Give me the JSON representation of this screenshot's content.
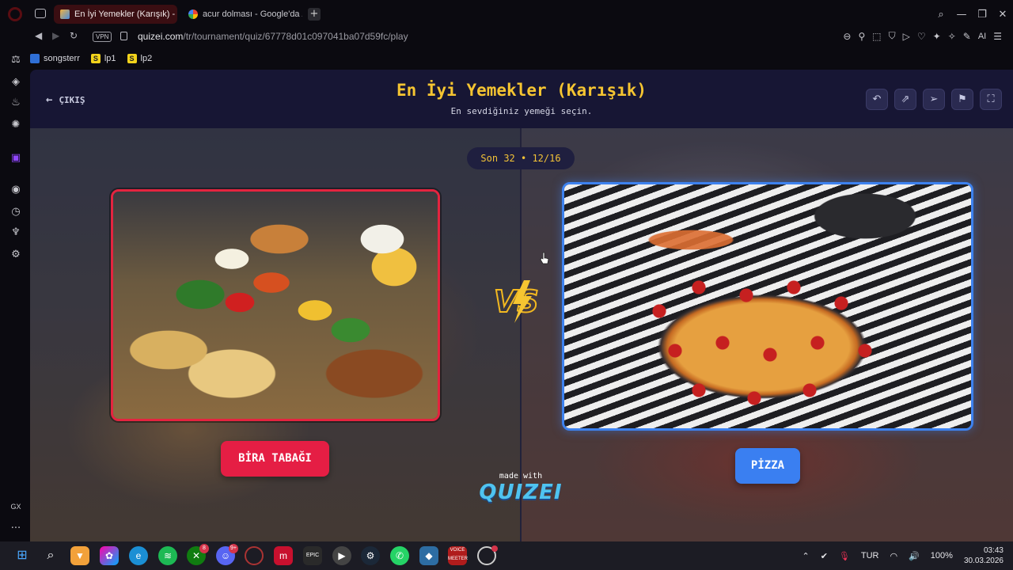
{
  "browser": {
    "tabs": [
      {
        "title": "En İyi Yemekler (Karışık) -",
        "active": true
      },
      {
        "title": "acur dolması - Google'da /",
        "active": false
      }
    ],
    "new_tab_label": "+",
    "vpn_label": "VPN",
    "url_host": "quizei.com",
    "url_path": "/tr/tournament/quiz/67778d01c097041ba07d59fc/play",
    "ai_label": "AI",
    "bookmarks": [
      {
        "label": "songsterr",
        "icon_char": "",
        "icon": "songsterr-icon"
      },
      {
        "label": "lp1",
        "icon_char": "S",
        "icon": "s-icon"
      },
      {
        "label": "lp2",
        "icon_char": "S",
        "icon": "s-icon"
      }
    ],
    "sidebar_gx_label": "GX",
    "sidebar_more_label": "···"
  },
  "page": {
    "back_label": "ÇIKIŞ",
    "title": "En İyi Yemekler (Karışık)",
    "subtitle": "En sevdiğiniz yemeği seçin.",
    "round": "Son 32 • 12/16",
    "left_choice": {
      "label": "BİRA TABAĞI",
      "image": "bira-tabagi-platter"
    },
    "right_choice": {
      "label": "PİZZA",
      "image": "pepperoni-pizza"
    },
    "vs_label": "VS",
    "made_with": "made with",
    "brand": "QUIZEI"
  },
  "colors": {
    "title": "#f6c531",
    "left_accent": "#e51e44",
    "right_accent": "#3a7ff1",
    "header_bg": "#171634"
  },
  "taskbar": {
    "language": "TUR",
    "battery": "100%",
    "time": "03:43",
    "date": "30.03.2026",
    "xbox_badge": "8",
    "discord_badge": "9+"
  }
}
